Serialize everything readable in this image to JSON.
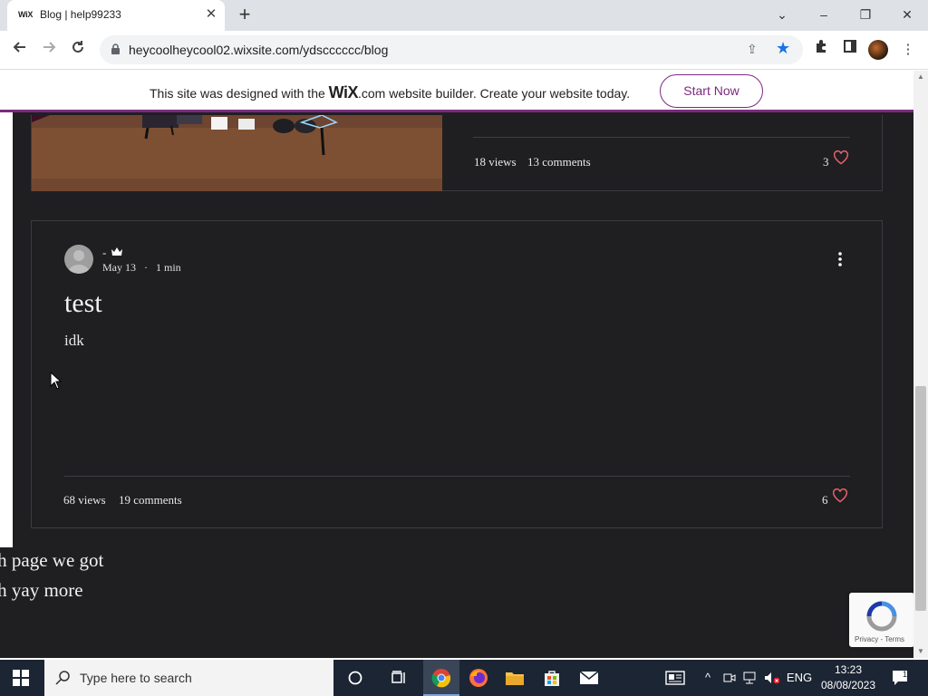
{
  "browser": {
    "tab_title": "Blog | help99233",
    "tab_favicon": "WiX",
    "url": "heycoolheycool02.wixsite.com/ydscccccc/blog",
    "controls": {
      "minimize": "–",
      "restore": "❐",
      "close": "✕",
      "tab_list": "⌄"
    }
  },
  "wix_banner": {
    "text_before": "This site was designed with the ",
    "brand": "WiX",
    "text_after": ".com website builder. Create your website today.",
    "cta": "Start Now",
    "accent": "#7b2a7e"
  },
  "posts": [
    {
      "views": "18 views",
      "comments": "13 comments",
      "likes": "3"
    },
    {
      "author": "-",
      "date": "May 13",
      "read_time": "1 min",
      "title": "test",
      "excerpt": "idk",
      "views": "68 views",
      "comments": "19 comments",
      "likes": "6"
    }
  ],
  "body_text": {
    "line1": "iah page we got",
    "line2": "iah yay more"
  },
  "recaptcha": {
    "privacy": "Privacy",
    "terms": "Terms"
  },
  "taskbar": {
    "search_placeholder": "Type here to search",
    "language": "ENG",
    "time": "13:23",
    "date": "08/08/2023",
    "notification_count": "1"
  },
  "colors": {
    "page_bg": "#1f1f22",
    "heart": "#e8616a",
    "chrome_star": "#1a73e8",
    "taskbar": "#1c2533"
  }
}
